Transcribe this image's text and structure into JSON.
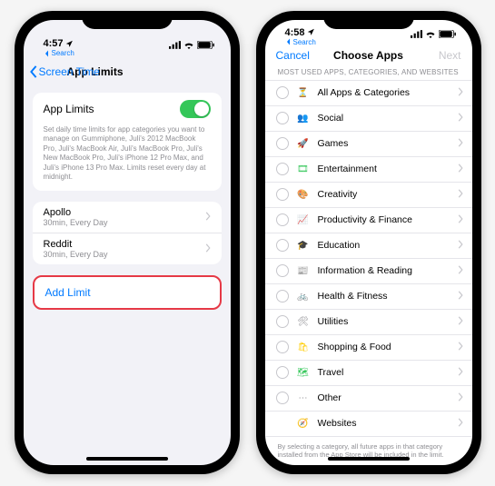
{
  "left": {
    "statusbar": {
      "time": "4:57",
      "search_label": "Search"
    },
    "nav": {
      "back": "Screen Time",
      "title": "App Limits"
    },
    "toggle_label": "App Limits",
    "description": "Set daily time limits for app categories you want to manage on Gummiphone, Juli's 2012 MacBook Pro, Juli's MacBook Air, Juli's MacBook Pro, Juli's New MacBook Pro, Juli's iPhone 12 Pro Max, and Juli's iPhone 13 Pro Max. Limits reset every day at midnight.",
    "limits": [
      {
        "name": "Apollo",
        "sub": "30min, Every Day"
      },
      {
        "name": "Reddit",
        "sub": "30min, Every Day"
      }
    ],
    "add_label": "Add Limit"
  },
  "right": {
    "statusbar": {
      "time": "4:58",
      "search_label": "Search"
    },
    "nav": {
      "cancel": "Cancel",
      "title": "Choose Apps",
      "next": "Next"
    },
    "section_header": "MOST USED APPS, CATEGORIES, AND WEBSITES",
    "categories": [
      {
        "label": "All Apps & Categories",
        "icon": "⏳",
        "color": "#5856d6"
      },
      {
        "label": "Social",
        "icon": "👥",
        "color": "#ff3b30"
      },
      {
        "label": "Games",
        "icon": "🚀",
        "color": "#2aa9e0"
      },
      {
        "label": "Entertainment",
        "icon": "🎞",
        "color": "#34c759"
      },
      {
        "label": "Creativity",
        "icon": "🎨",
        "color": "#ff9500"
      },
      {
        "label": "Productivity & Finance",
        "icon": "📈",
        "color": "#007aff"
      },
      {
        "label": "Education",
        "icon": "🎓",
        "color": "#30b0c7"
      },
      {
        "label": "Information & Reading",
        "icon": "📰",
        "color": "#5ac8fa"
      },
      {
        "label": "Health & Fitness",
        "icon": "🚲",
        "color": "#4cd964"
      },
      {
        "label": "Utilities",
        "icon": "🛠",
        "color": "#8e8e93"
      },
      {
        "label": "Shopping & Food",
        "icon": "🛍",
        "color": "#ffcc00"
      },
      {
        "label": "Travel",
        "icon": "🗺",
        "color": "#34c759"
      },
      {
        "label": "Other",
        "icon": "⋯",
        "color": "#8e8e93"
      },
      {
        "label": "Websites",
        "icon": "🧭",
        "color": "#c7c7cc"
      }
    ],
    "footer": "By selecting a category, all future apps in that category installed from the App Store will be included in the limit."
  }
}
